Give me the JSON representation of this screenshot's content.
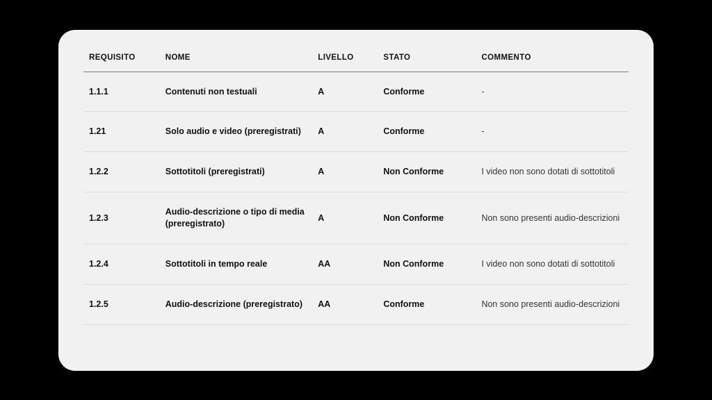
{
  "chart_data": {
    "type": "table",
    "title": "",
    "columns": [
      "REQUISITO",
      "NOME",
      "LIVELLO",
      "STATO",
      "COMMENTO"
    ],
    "rows": [
      [
        "1.1.1",
        "Contenuti non testuali",
        "A",
        "Conforme",
        "-"
      ],
      [
        "1.21",
        "Solo audio e video (preregistrati)",
        "A",
        "Conforme",
        "-"
      ],
      [
        "1.2.2",
        "Sottotitoli (preregistrati)",
        "A",
        "Non Conforme",
        "I video non sono dotati di sottotitoli"
      ],
      [
        "1.2.3",
        "Audio-descrizione o tipo di media (preregistrato)",
        "A",
        "Non Conforme",
        "Non sono presenti audio-descrizioni"
      ],
      [
        "1.2.4",
        "Sottotitoli in tempo reale",
        "AA",
        "Non Conforme",
        "I video non sono dotati di sottotitoli"
      ],
      [
        "1.2.5",
        "Audio-descrizione (preregistrato)",
        "AA",
        "Conforme",
        "Non sono presenti audio-descrizioni"
      ]
    ]
  },
  "headers": {
    "requisito": "REQUISITO",
    "nome": "NOME",
    "livello": "LIVELLO",
    "stato": "STATO",
    "commento": "COMMENTO"
  },
  "rows": [
    {
      "requisito": "1.1.1",
      "nome": "Contenuti non testuali",
      "livello": "A",
      "stato": "Conforme",
      "commento": "-"
    },
    {
      "requisito": "1.21",
      "nome": "Solo audio e video (preregistrati)",
      "livello": "A",
      "stato": "Conforme",
      "commento": "-"
    },
    {
      "requisito": "1.2.2",
      "nome": "Sottotitoli (preregistrati)",
      "livello": "A",
      "stato": "Non Conforme",
      "commento": "I video non sono dotati di sottotitoli"
    },
    {
      "requisito": "1.2.3",
      "nome": "Audio-descrizione o tipo di media (preregistrato)",
      "livello": "A",
      "stato": "Non Conforme",
      "commento": "Non sono presenti audio-descrizioni"
    },
    {
      "requisito": "1.2.4",
      "nome": "Sottotitoli in tempo reale",
      "livello": "AA",
      "stato": "Non Conforme",
      "commento": "I video non sono dotati di sottotitoli"
    },
    {
      "requisito": "1.2.5",
      "nome": "Audio-descrizione (preregistrato)",
      "livello": "AA",
      "stato": "Conforme",
      "commento": "Non sono presenti audio-descrizioni"
    }
  ]
}
